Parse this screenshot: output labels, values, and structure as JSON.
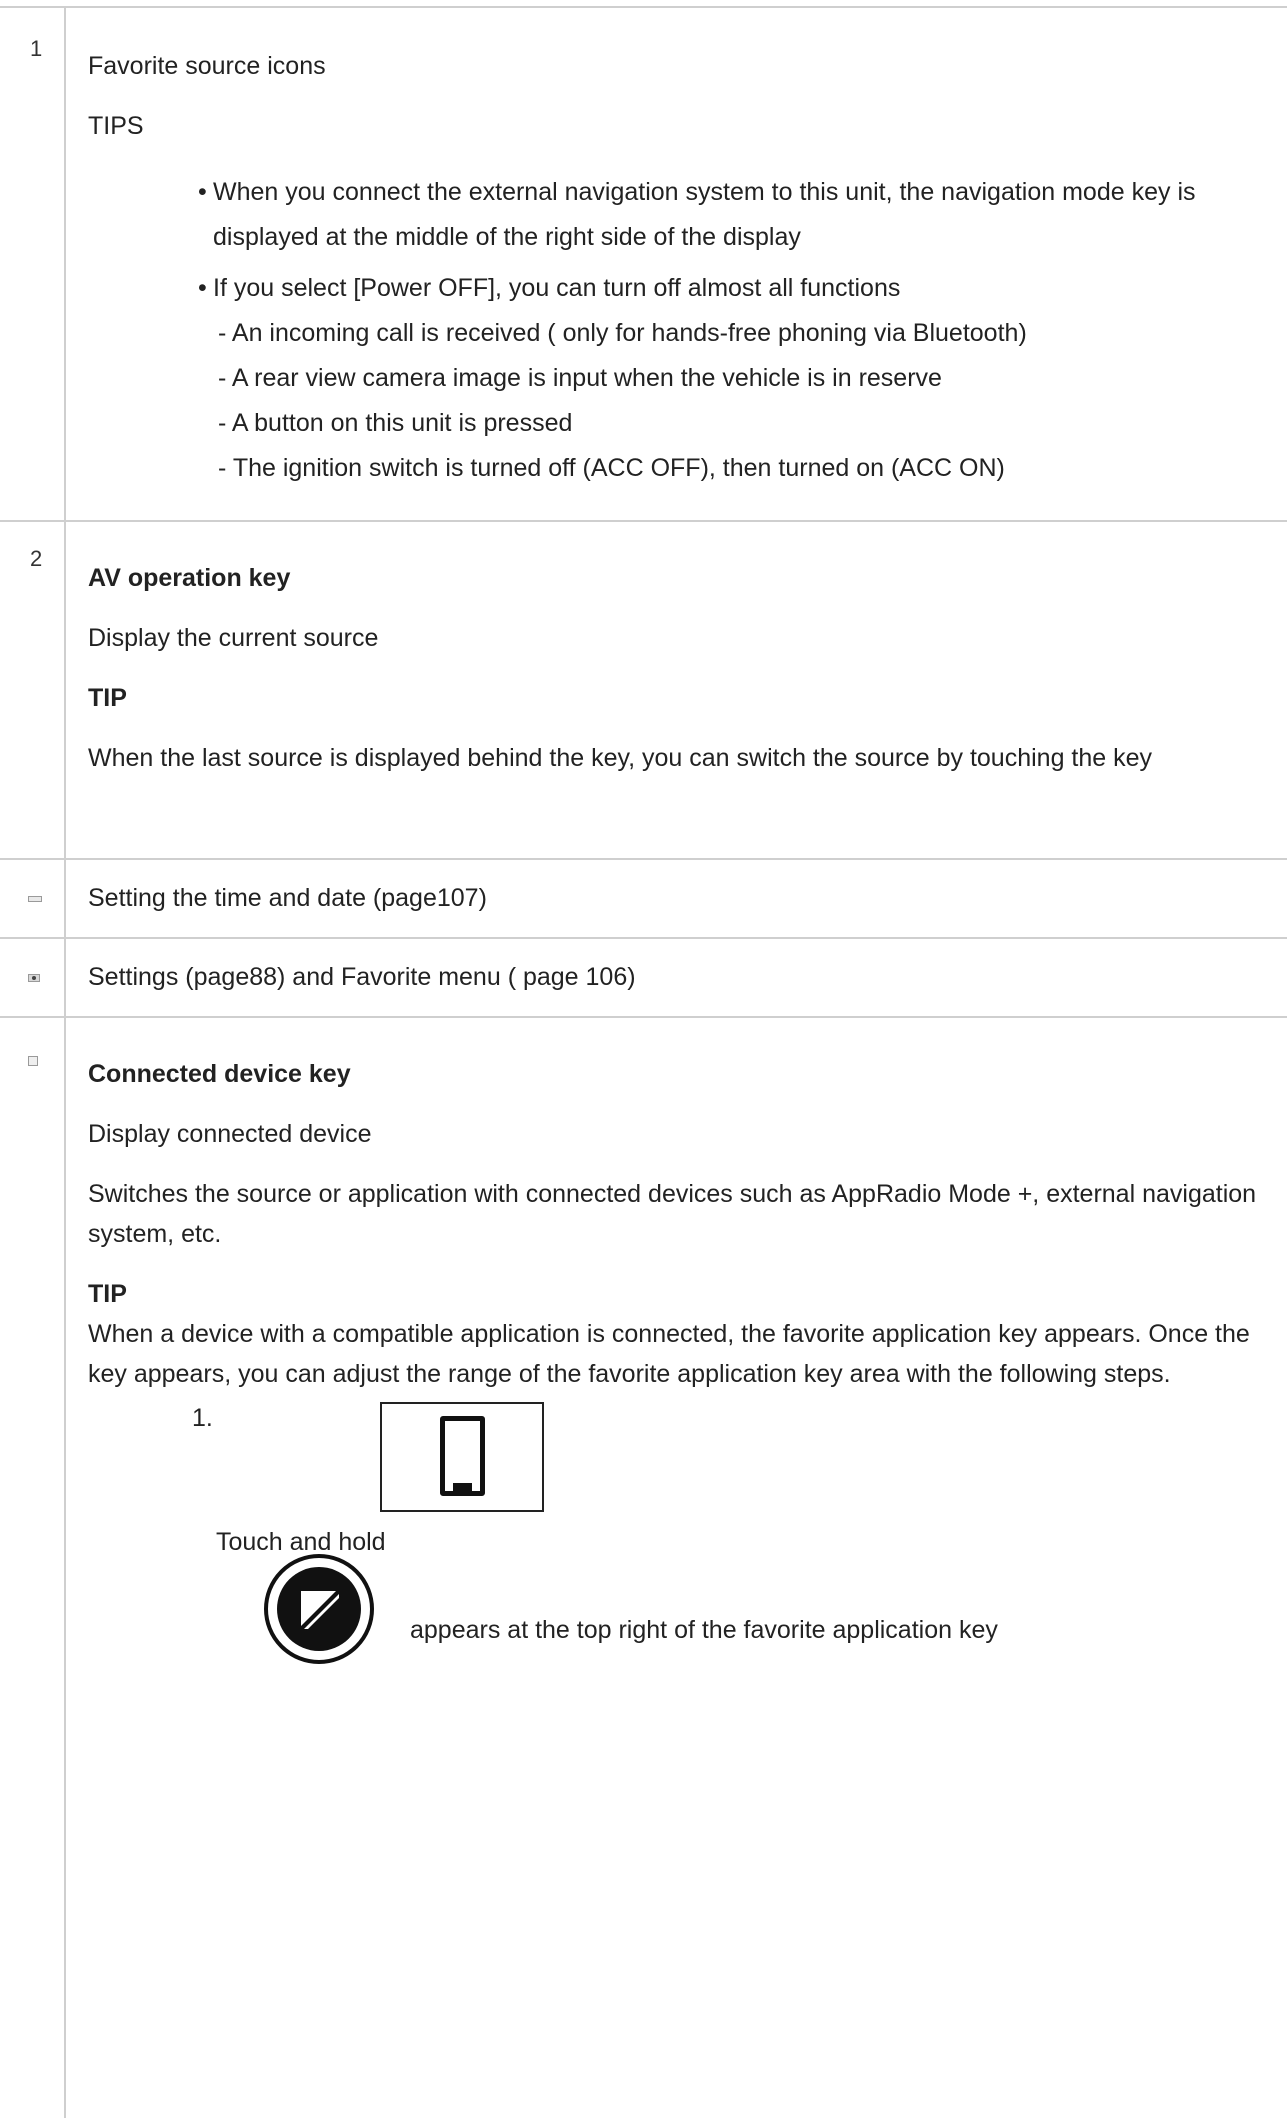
{
  "rows": [
    {
      "number": "1",
      "title": "Favorite source icons",
      "tips_heading": "TIPS",
      "bullets": [
        {
          "bullet": "•",
          "text": "When you connect the external navigation system to this unit, the navigation mode key is displayed at the middle of the right side of the display"
        },
        {
          "bullet": "•",
          "text": "If you select [Power OFF], you can turn off almost all functions",
          "sub_items": [
            "- An incoming call is received ( only for hands-free phoning via Bluetooth)",
            "- A rear view camera image is input when the vehicle is in reserve",
            "- A button on this unit is pressed",
            "- The ignition switch is turned off (ACC OFF), then turned on (ACC ON)"
          ]
        }
      ]
    },
    {
      "number": "2",
      "title": "AV operation key",
      "description": "Display the current source",
      "tip_heading": "TIP",
      "tip_text": "When the last source is displayed behind the key, you can switch the source by touching the key"
    },
    {
      "icon": "clock-key-icon",
      "text": "Setting the time and date (page107)"
    },
    {
      "icon": "settings-key-icon",
      "text": "Settings (page88) and Favorite menu ( page 106)"
    },
    {
      "icon": "connected-device-key-icon",
      "title": "Connected device key",
      "description": "Display connected device",
      "detail": "Switches the source or application with connected devices such as AppRadio Mode +, external navigation system, etc.",
      "tip_heading": "TIP",
      "tip_text": "When a device with a compatible application is connected, the favorite application key appears. Once the key appears, you can adjust the range of the favorite application key area with the following steps.",
      "steps": [
        {
          "number": "1.",
          "instruction": "Touch and hold",
          "result": "appears at the top right of the favorite application key"
        }
      ]
    }
  ]
}
